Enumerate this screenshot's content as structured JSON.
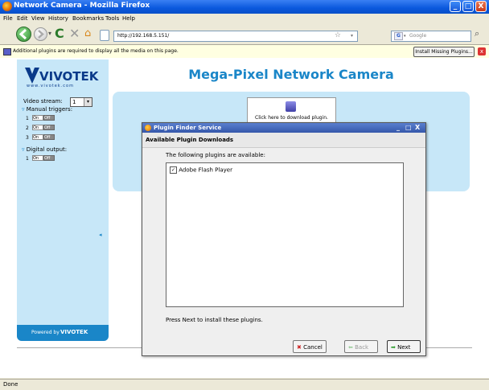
{
  "window": {
    "title": "Network Camera - Mozilla Firefox",
    "min": "_",
    "max": "□",
    "close": "X"
  },
  "menu": [
    "File",
    "Edit",
    "View",
    "History",
    "Bookmarks",
    "Tools",
    "Help"
  ],
  "nav": {
    "url": "http://192.168.5.151/",
    "search_placeholder": "Google",
    "star": "☆"
  },
  "infobar": {
    "message": "Additional plugins are required to display all the media on this page.",
    "install_label": "Install Missing Plugins...",
    "close": "x"
  },
  "sidebar": {
    "logo": "VIVOTEK",
    "logo_sub": "www.vivotek.com",
    "video_stream_label": "Video stream:",
    "video_stream_value": "1",
    "manual_triggers_label": "Manual triggers:",
    "triggers": [
      {
        "num": "1",
        "on": "On",
        "off": "Off"
      },
      {
        "num": "2",
        "on": "On",
        "off": "Off"
      },
      {
        "num": "3",
        "on": "On",
        "off": "Off"
      }
    ],
    "digital_output_label": "Digital output:",
    "outputs": [
      {
        "num": "1",
        "on": "On",
        "off": "Off"
      }
    ],
    "powered_by": "Powered by",
    "powered_logo": "VIVOTEK"
  },
  "main": {
    "title": "Mega-Pixel Network Camera",
    "download_text": "Click here to download plugin."
  },
  "dialog": {
    "title": "Plugin Finder Service",
    "header": "Available Plugin Downloads",
    "intro": "The following plugins are available:",
    "plugins": [
      {
        "name": "Adobe Flash Player",
        "checked": true
      }
    ],
    "footer_text": "Press Next to install these plugins.",
    "cancel": "Cancel",
    "back": "Back",
    "next": "Next",
    "min": "_",
    "max": "□",
    "close": "X"
  },
  "status": {
    "text": "Done"
  },
  "colors": {
    "accent": "#1a86c8",
    "panel": "#c7e7f8",
    "titlebar": "#0a58dd"
  }
}
